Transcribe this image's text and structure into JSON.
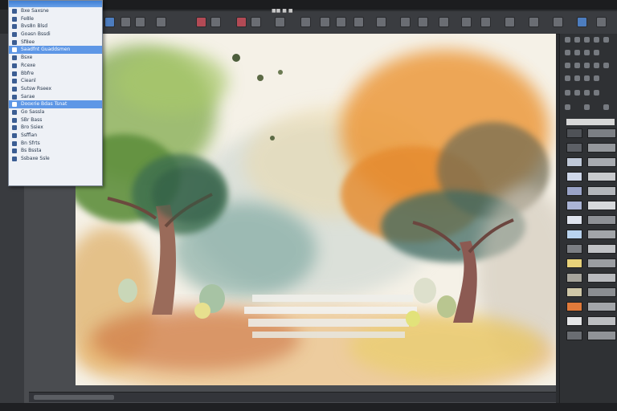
{
  "toolbar": {
    "label": "■■ ■ ■"
  },
  "menu": {
    "items": [
      {
        "label": "Bxe  Saxsne"
      },
      {
        "label": "Fe8le"
      },
      {
        "label": "Bvs8n Blsd"
      },
      {
        "label": "Goasn Bssdi"
      },
      {
        "label": "Sf8ee"
      },
      {
        "label": "Saadfnt Guaddsmen",
        "highlight": true
      },
      {
        "label": "Bsxe"
      },
      {
        "label": "Rcexe"
      },
      {
        "label": "Bbfre"
      },
      {
        "label": "Cieanl"
      },
      {
        "label": "Sutsw Rseex"
      },
      {
        "label": "Sarae"
      },
      {
        "label": "Dooxrie  Bdas Tsnat",
        "highlight": true
      },
      {
        "label": "Go Sassla"
      },
      {
        "label": "SBr Bass"
      },
      {
        "label": "Bro Ssiex"
      },
      {
        "label": "Ssfflan"
      },
      {
        "label": "Bn Sfrts"
      },
      {
        "label": "Bs Bssta"
      },
      {
        "label": "Ssbaxe Ssle"
      }
    ]
  },
  "swatches": [
    {
      "a": "#4f5257",
      "b": "#7c7f84"
    },
    {
      "a": "#5d6066",
      "b": "#95989c"
    },
    {
      "a": "#bfc8d8",
      "b": "#a8abb0"
    },
    {
      "a": "#cfd8ea",
      "b": "#c9cbce"
    },
    {
      "a": "#9aa4c8",
      "b": "#b3b6ba"
    },
    {
      "a": "#aab4d6",
      "b": "#d7d9dc"
    },
    {
      "a": "#dfe4ee",
      "b": "#8e9196"
    },
    {
      "a": "#b9d3ef",
      "b": "#a2a5a9"
    },
    {
      "a": "#7c7f84",
      "b": "#c0c2c5"
    },
    {
      "a": "#e8d27a",
      "b": "#9b9ea2"
    },
    {
      "a": "#a7a59c",
      "b": "#b9bbbe"
    },
    {
      "a": "#cfc7a8",
      "b": "#8b8e92"
    },
    {
      "a": "#e07a3a",
      "b": "#a3a6aa"
    },
    {
      "a": "#e5e6e8",
      "b": "#bdbfc2"
    },
    {
      "a": "#6a6d72",
      "b": "#909397"
    }
  ],
  "colors": {
    "accent": "#5e97e6",
    "panel": "#2f3134",
    "canvas": "#f4f0e6"
  }
}
